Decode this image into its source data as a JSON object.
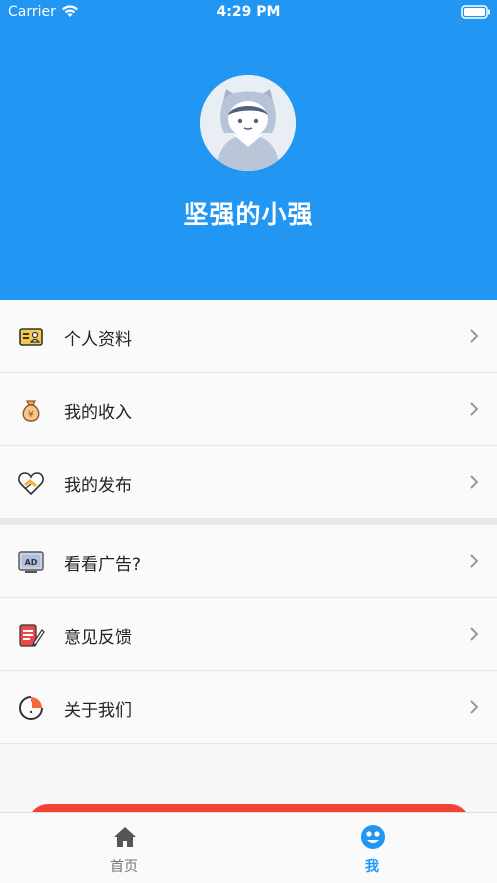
{
  "status_bar": {
    "carrier": "Carrier",
    "time": "4:29 PM"
  },
  "profile": {
    "username": "坚强的小强"
  },
  "menu": {
    "group1": [
      {
        "label": "个人资料",
        "icon": "profile-card-icon"
      },
      {
        "label": "我的收入",
        "icon": "money-bag-icon"
      },
      {
        "label": "我的发布",
        "icon": "handshake-heart-icon"
      }
    ],
    "group2": [
      {
        "label": "看看广告?",
        "icon": "ad-screen-icon"
      },
      {
        "label": "意见反馈",
        "icon": "feedback-notepad-icon"
      },
      {
        "label": "关于我们",
        "icon": "about-info-icon"
      }
    ]
  },
  "tabbar": {
    "home_label": "首页",
    "me_label": "我"
  },
  "colors": {
    "primary": "#2196f3",
    "danger": "#f44336"
  }
}
